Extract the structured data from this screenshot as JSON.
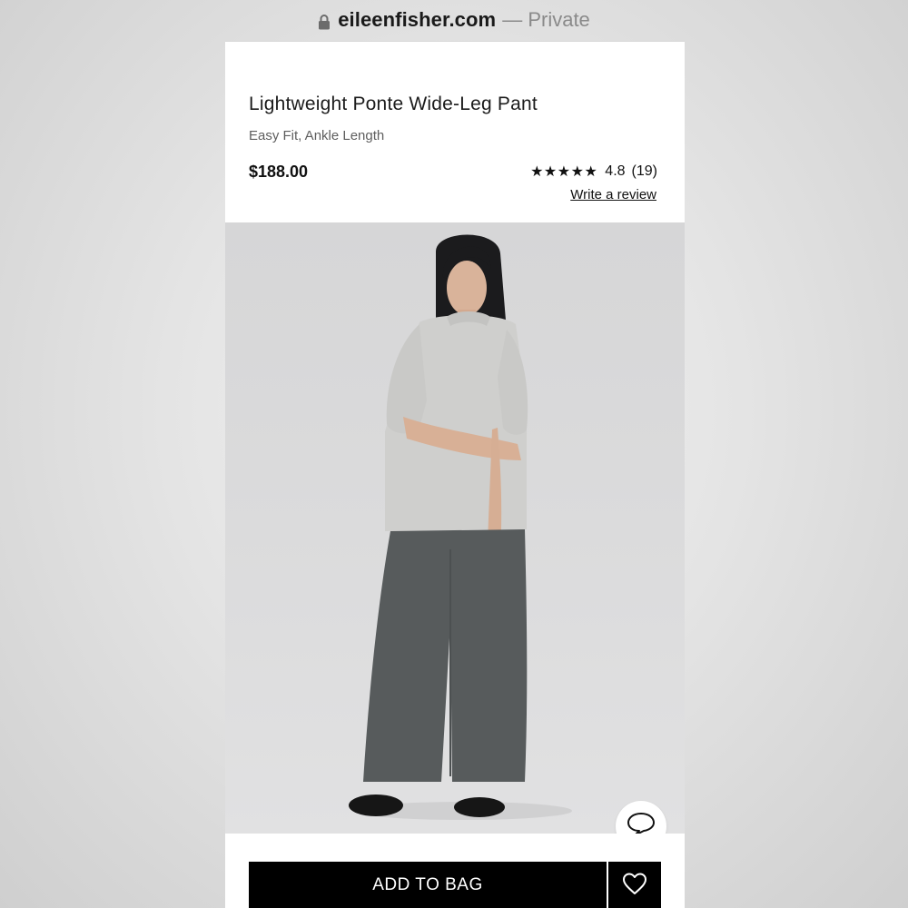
{
  "browser": {
    "domain": "eileenfisher.com",
    "privacy": "— Private"
  },
  "product": {
    "title": "Lightweight Ponte Wide-Leg Pant",
    "subtitle": "Easy Fit, Ankle Length",
    "price": "$188.00",
    "stars": "★★★★★",
    "rating": "4.8",
    "review_count": "(19)",
    "write_review": "Write a review"
  },
  "actions": {
    "add_to_bag": "ADD TO BAG"
  },
  "icons": {
    "lock": "lock-icon",
    "chat": "chat-bubble-icon",
    "wishlist": "heart-icon"
  },
  "colors": {
    "button": "#000000",
    "pants": "#575b5c",
    "sweater": "#cfcfcd",
    "background": "#d9d9da"
  }
}
